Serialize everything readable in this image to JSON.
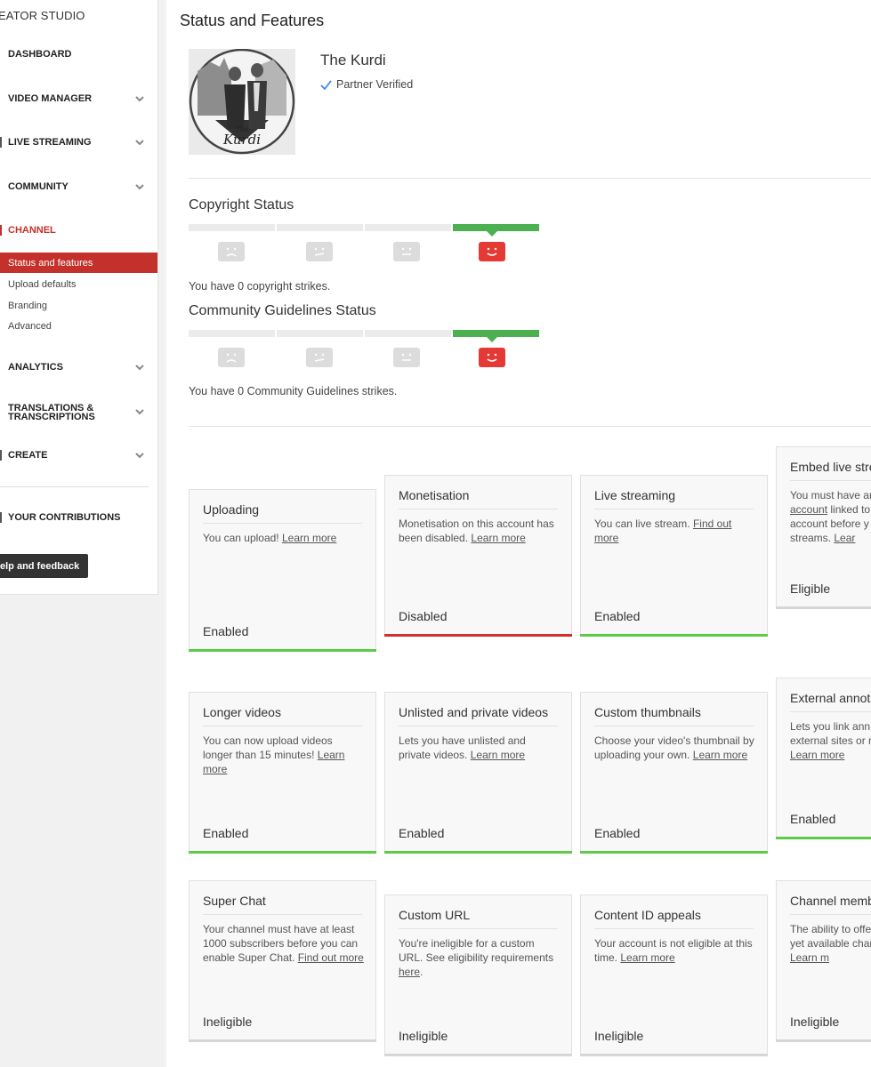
{
  "sidebar": {
    "brand": "EATOR STUDIO",
    "items": [
      {
        "label": "DASHBOARD"
      },
      {
        "label": "VIDEO MANAGER"
      },
      {
        "label": "LIVE STREAMING"
      },
      {
        "label": "COMMUNITY"
      },
      {
        "label": "CHANNEL"
      },
      {
        "label": "ANALYTICS"
      },
      {
        "label": "TRANSLATIONS &"
      },
      {
        "label": "TRANSCRIPTIONS"
      },
      {
        "label": "CREATE"
      },
      {
        "label": "YOUR CONTRIBUTIONS"
      }
    ],
    "channel_sub": [
      "Status and features",
      "Upload defaults",
      "Branding",
      "Advanced"
    ],
    "help": "elp and feedback"
  },
  "main": {
    "title": "Status and Features",
    "channel_name": "The Kurdi",
    "partner": "Partner Verified",
    "avatar_text": {
      "small": "The",
      "big": "Kurdi"
    },
    "copyright": {
      "title": "Copyright Status",
      "text": "You have 0 copyright strikes."
    },
    "community": {
      "title": "Community Guidelines Status",
      "text": "You have 0 Community Guidelines strikes."
    }
  },
  "cards": [
    {
      "title": "Uploading",
      "desc": "You can upload!",
      "link": "Learn more",
      "status": "Enabled",
      "bar": "green"
    },
    {
      "title": "Monetisation",
      "desc": "Monetisation on this account has been disabled.",
      "link": "Learn more",
      "status": "Disabled",
      "bar": "red"
    },
    {
      "title": "Live streaming",
      "desc": "You can live stream.",
      "link": "Find out more",
      "status": "Enabled",
      "bar": "green"
    },
    {
      "title": "Embed live stre",
      "desc": "You must have an",
      "link": "account",
      "desc2": "linked to account before y live streams.",
      "link2": "Lear",
      "status": "Eligible",
      "bar": "gray"
    },
    {
      "title": "Longer videos",
      "desc": "You can now upload videos longer than 15 minutes!",
      "link": "Learn more",
      "status": "Enabled",
      "bar": "green"
    },
    {
      "title": "Unlisted and private videos",
      "desc": "Lets you have unlisted and private videos.",
      "link": "Learn more",
      "status": "Enabled",
      "bar": "green"
    },
    {
      "title": "Custom thumbnails",
      "desc": "Choose your video's thumbnail by uploading your own.",
      "link": "Learn more",
      "status": "Enabled",
      "bar": "green"
    },
    {
      "title": "External annota",
      "desc": "Lets you link ann external sites or r",
      "link": "Learn more",
      "status": "Enabled",
      "bar": "green"
    },
    {
      "title": "Super Chat",
      "desc": "Your channel must have at least 1000 subscribers before you can enable Super Chat.",
      "link": "Find out more",
      "status": "Ineligible",
      "bar": "gray"
    },
    {
      "title": "Custom URL",
      "desc": "You're ineligible for a custom URL. See eligibility requirements",
      "link": "here",
      "tail": ".",
      "status": "Ineligible",
      "bar": "gray"
    },
    {
      "title": "Content ID appeals",
      "desc": "Your account is not eligible at this time.",
      "link": "Learn more",
      "status": "Ineligible",
      "bar": "gray"
    },
    {
      "title": "Channel memb",
      "desc": "The ability to offe isn't yet available channel.",
      "link": "Learn m",
      "status": "Ineligible",
      "bar": "gray"
    }
  ],
  "colors": {
    "accent": "#c4302b",
    "green": "#5ccc48",
    "red": "#d32f2f"
  }
}
